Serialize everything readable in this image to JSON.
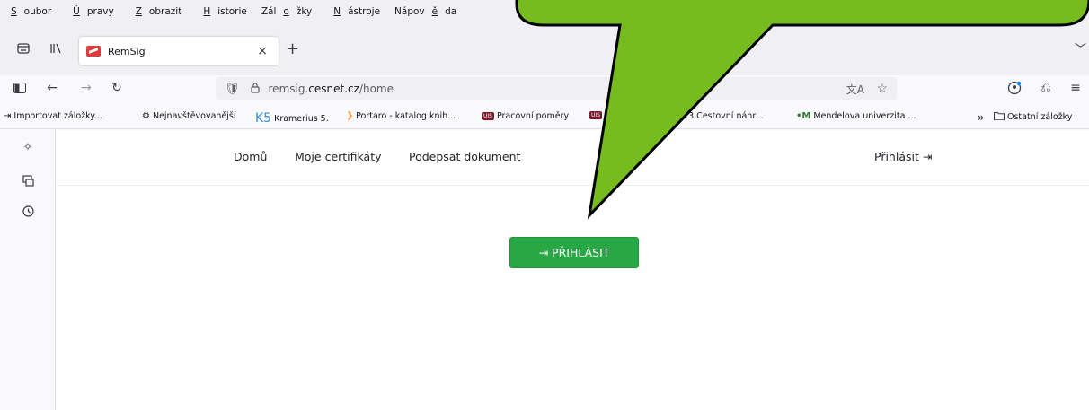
{
  "menu": [
    {
      "before": "",
      "key": "S",
      "after": "oubor"
    },
    {
      "before": "",
      "key": "Ú",
      "after": "pravy"
    },
    {
      "before": "",
      "key": "Z",
      "after": "obrazit"
    },
    {
      "before": "",
      "key": "H",
      "after": "istorie"
    },
    {
      "before": "Zál",
      "key": "o",
      "after": "žky"
    },
    {
      "before": "",
      "key": "N",
      "after": "ástroje"
    },
    {
      "before": "Nápov",
      "key": "ě",
      "after": "da"
    }
  ],
  "tab": {
    "title": "RemSig",
    "close": "×"
  },
  "newtab": "+",
  "tablist": "﹀",
  "url": {
    "prefix": "remsig.",
    "domain": "cesnet.cz",
    "path": "/home"
  },
  "bookmarks": [
    {
      "icon": "⇥",
      "label": "Importovat záložky..."
    },
    {
      "icon": "⚙",
      "label": "Nejnavštěvovanější"
    },
    {
      "icon": "K5",
      "label": "Kramerius 5."
    },
    {
      "icon": "}",
      "label": "Portaro - katalog knih..."
    },
    {
      "icon": "UIS",
      "label": "Pracovní poměry"
    },
    {
      "icon": "UIS",
      "label": ""
    },
    {
      "icon": "",
      "label": "...2.3 Cestovní náhr..."
    },
    {
      "icon": "•M",
      "label": "Mendelova univerzita ..."
    }
  ],
  "bookmarks_more": "»",
  "other_bookmarks": "Ostatní záložky",
  "site": {
    "nav": [
      "Domů",
      "Moje certifikáty",
      "Podepsat dokument"
    ],
    "login_link": "Přihlásit",
    "login_button": "PŘIHLÁSIT"
  },
  "colors": {
    "callout": "#77bc1f",
    "button": "#28a745"
  }
}
